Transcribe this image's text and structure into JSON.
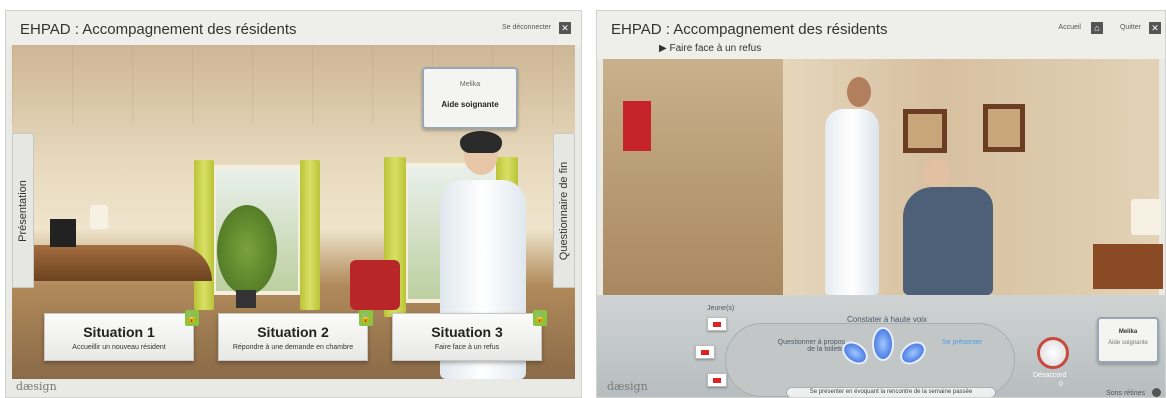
{
  "left_panel": {
    "title": "EHPAD : Accompagnement des résidents",
    "logout_label": "Se déconnecter",
    "close_icon": "close-icon",
    "side_tabs": {
      "left": "Présentation",
      "right": "Questionnaire de fin"
    },
    "badge": {
      "name": "Melika",
      "role": "Aide soignante"
    },
    "situations": [
      {
        "title": "Situation 1",
        "subtitle": "Accueillir un nouveau résident"
      },
      {
        "title": "Situation 2",
        "subtitle": "Répondre à une demande en chambre"
      },
      {
        "title": "Situation 3",
        "subtitle": "Faire face à un refus"
      }
    ],
    "logo": "dæsign"
  },
  "right_panel": {
    "title": "EHPAD : Accompagnement des résidents",
    "breadcrumb": "Faire face à un refus",
    "home_label": "Accueil",
    "quit_label": "Quitter",
    "controls": {
      "top_label": "Constater à haute voix",
      "left_label": "Questionner à propos de la toilette",
      "right_label": "Se présenter",
      "bottom_label": "Se présenter en évoquant la rencontre de la semaine passée",
      "options_label": "Jeune(s)",
      "gauge_label": "Désaccord",
      "gauge_value": "0"
    },
    "badge": {
      "name": "Melika",
      "role": "Aide soignante"
    },
    "sound_label": "Sons rétines",
    "logo": "dæsign"
  }
}
